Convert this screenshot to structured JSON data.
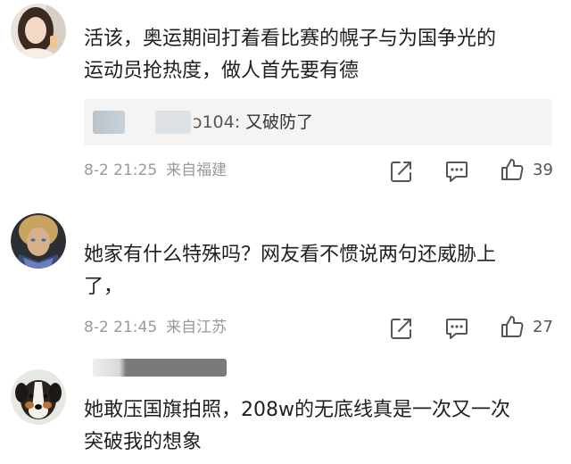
{
  "comments": [
    {
      "text_line1": "活该，奥运期间打着看比赛的幌子与为国争光的",
      "text_line2": "运动员抢热度，做人首先要有德",
      "reply": {
        "username_visible": "104:",
        "username_prefix": "ͻ",
        "text": "又破防了"
      },
      "date": "8-2 21:25",
      "location": "来自福建",
      "likes": "39"
    },
    {
      "text_line1": "她家有什么特殊吗？网友看不惯说两句还威胁上",
      "text_line2": "了，",
      "date": "8-2 21:45",
      "location": "来自江苏",
      "likes": "27"
    },
    {
      "text_line1": "她敢压国旗拍照，208w的无底线真是一次又一次",
      "text_line2": "突破我的想象"
    }
  ],
  "icons": {
    "share": "share-square-icon",
    "comment": "comment-bubble-icon",
    "like": "thumbs-up-icon"
  },
  "colors": {
    "meta_text": "#999999",
    "reply_bg": "#f4f4f4",
    "icon_stroke": "#555555"
  }
}
